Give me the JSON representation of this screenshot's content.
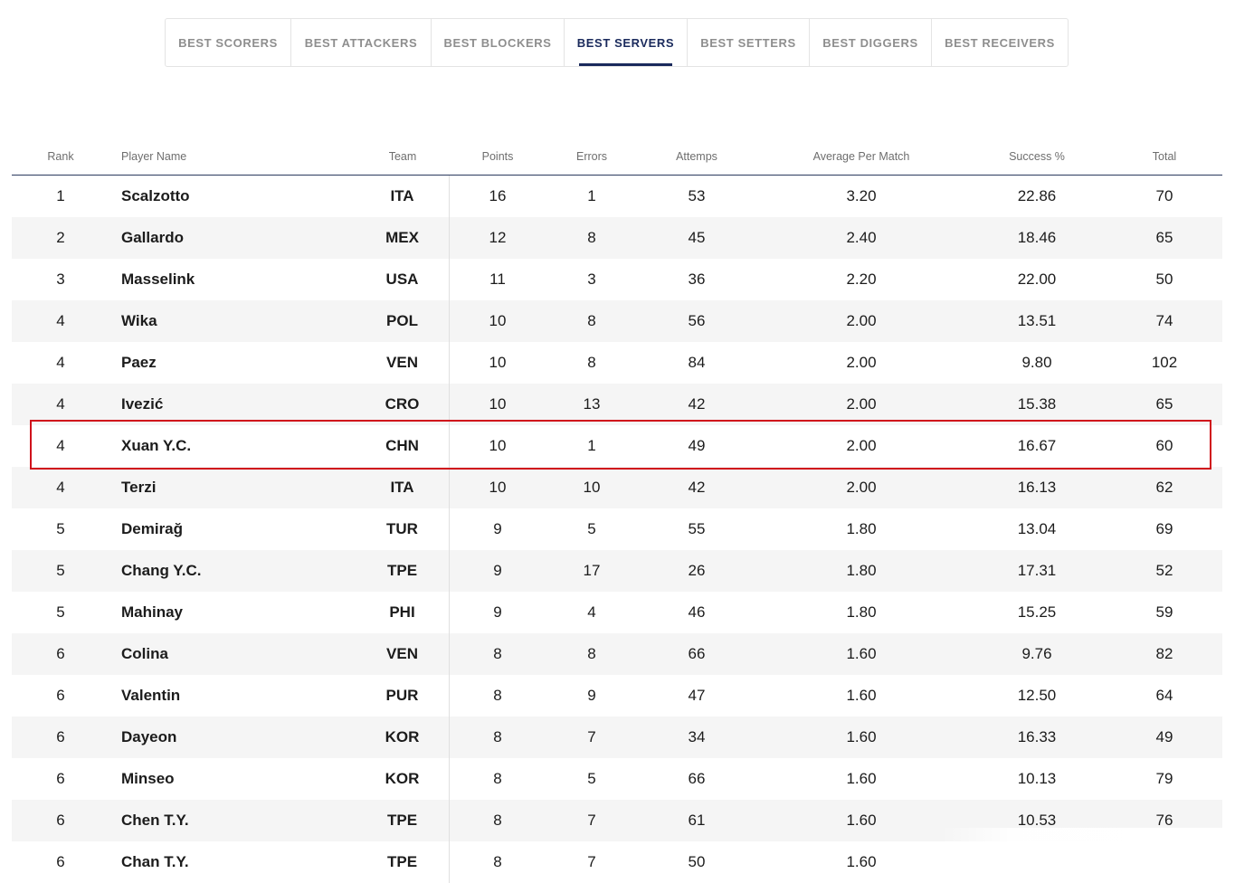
{
  "tabs": [
    {
      "label": "BEST SCORERS",
      "active": false
    },
    {
      "label": "BEST ATTACKERS",
      "active": false
    },
    {
      "label": "BEST BLOCKERS",
      "active": false
    },
    {
      "label": "BEST SERVERS",
      "active": true
    },
    {
      "label": "BEST SETTERS",
      "active": false
    },
    {
      "label": "BEST DIGGERS",
      "active": false
    },
    {
      "label": "BEST RECEIVERS",
      "active": false
    }
  ],
  "table": {
    "headers": {
      "rank": "Rank",
      "name": "Player Name",
      "team": "Team",
      "points": "Points",
      "errors": "Errors",
      "attempts": "Attemps",
      "avg": "Average Per Match",
      "success": "Success %",
      "total": "Total"
    },
    "rows": [
      {
        "rank": "1",
        "name": "Scalzotto",
        "team": "ITA",
        "points": "16",
        "errors": "1",
        "attempts": "53",
        "avg": "3.20",
        "success": "22.86",
        "total": "70"
      },
      {
        "rank": "2",
        "name": "Gallardo",
        "team": "MEX",
        "points": "12",
        "errors": "8",
        "attempts": "45",
        "avg": "2.40",
        "success": "18.46",
        "total": "65"
      },
      {
        "rank": "3",
        "name": "Masselink",
        "team": "USA",
        "points": "11",
        "errors": "3",
        "attempts": "36",
        "avg": "2.20",
        "success": "22.00",
        "total": "50"
      },
      {
        "rank": "4",
        "name": "Wika",
        "team": "POL",
        "points": "10",
        "errors": "8",
        "attempts": "56",
        "avg": "2.00",
        "success": "13.51",
        "total": "74"
      },
      {
        "rank": "4",
        "name": "Paez",
        "team": "VEN",
        "points": "10",
        "errors": "8",
        "attempts": "84",
        "avg": "2.00",
        "success": "9.80",
        "total": "102"
      },
      {
        "rank": "4",
        "name": "Ivezić",
        "team": "CRO",
        "points": "10",
        "errors": "13",
        "attempts": "42",
        "avg": "2.00",
        "success": "15.38",
        "total": "65"
      },
      {
        "rank": "4",
        "name": "Xuan Y.C.",
        "team": "CHN",
        "points": "10",
        "errors": "1",
        "attempts": "49",
        "avg": "2.00",
        "success": "16.67",
        "total": "60"
      },
      {
        "rank": "4",
        "name": "Terzi",
        "team": "ITA",
        "points": "10",
        "errors": "10",
        "attempts": "42",
        "avg": "2.00",
        "success": "16.13",
        "total": "62"
      },
      {
        "rank": "5",
        "name": "Demirağ",
        "team": "TUR",
        "points": "9",
        "errors": "5",
        "attempts": "55",
        "avg": "1.80",
        "success": "13.04",
        "total": "69"
      },
      {
        "rank": "5",
        "name": "Chang Y.C.",
        "team": "TPE",
        "points": "9",
        "errors": "17",
        "attempts": "26",
        "avg": "1.80",
        "success": "17.31",
        "total": "52"
      },
      {
        "rank": "5",
        "name": "Mahinay",
        "team": "PHI",
        "points": "9",
        "errors": "4",
        "attempts": "46",
        "avg": "1.80",
        "success": "15.25",
        "total": "59"
      },
      {
        "rank": "6",
        "name": "Colina",
        "team": "VEN",
        "points": "8",
        "errors": "8",
        "attempts": "66",
        "avg": "1.60",
        "success": "9.76",
        "total": "82"
      },
      {
        "rank": "6",
        "name": "Valentin",
        "team": "PUR",
        "points": "8",
        "errors": "9",
        "attempts": "47",
        "avg": "1.60",
        "success": "12.50",
        "total": "64"
      },
      {
        "rank": "6",
        "name": "Dayeon",
        "team": "KOR",
        "points": "8",
        "errors": "7",
        "attempts": "34",
        "avg": "1.60",
        "success": "16.33",
        "total": "49"
      },
      {
        "rank": "6",
        "name": "Minseo",
        "team": "KOR",
        "points": "8",
        "errors": "5",
        "attempts": "66",
        "avg": "1.60",
        "success": "10.13",
        "total": "79"
      },
      {
        "rank": "6",
        "name": "Chen T.Y.",
        "team": "TPE",
        "points": "8",
        "errors": "7",
        "attempts": "61",
        "avg": "1.60",
        "success": "10.53",
        "total": "76"
      },
      {
        "rank": "6",
        "name": "Chan T.Y.",
        "team": "TPE",
        "points": "8",
        "errors": "7",
        "attempts": "50",
        "avg": "1.60",
        "success": "",
        "total": ""
      }
    ]
  },
  "highlight": {
    "row_name": "Xuan Y.C.",
    "color": "#d0121b"
  },
  "colors": {
    "accent": "#1a2a5c",
    "row_stripe": "#f5f5f5"
  }
}
